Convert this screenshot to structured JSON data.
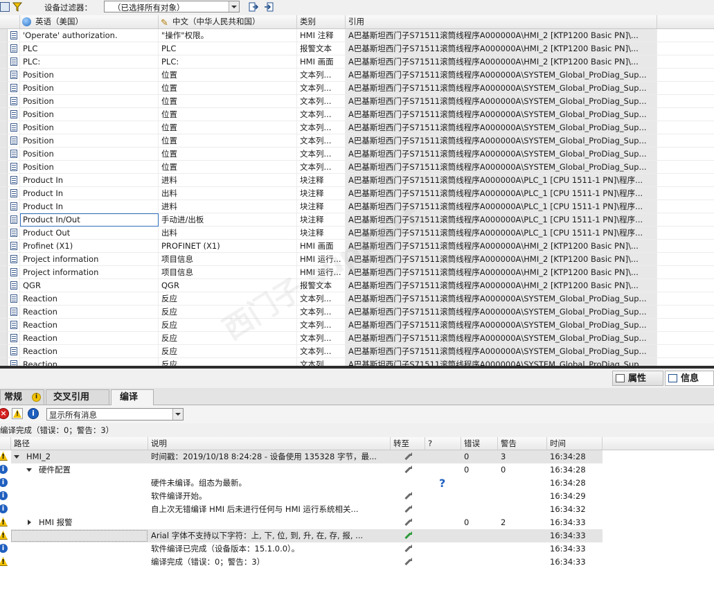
{
  "toolbar": {
    "filter_label": "设备过滤器：",
    "filter_value": "（已选择所有对象）"
  },
  "textlist": {
    "columns": {
      "en": "英语（美国）",
      "zh": "中文（中华人民共和国）",
      "category": "类别",
      "reference": "引用"
    },
    "rows": [
      {
        "en": "'Operate' authorization.",
        "zh": "\"操作\"权限。",
        "cat": "HMI 注释",
        "ref": "A巴基斯坦西门子S71511滚筒线程序A000000A\\HMI_2 [KTP1200 Basic PN]\\..."
      },
      {
        "en": "PLC",
        "zh": "PLC",
        "cat": "报警文本",
        "ref": "A巴基斯坦西门子S71511滚筒线程序A000000A\\HMI_2 [KTP1200 Basic PN]\\..."
      },
      {
        "en": "PLC:",
        "zh": "PLC:",
        "cat": "HMI 画面",
        "ref": "A巴基斯坦西门子S71511滚筒线程序A000000A\\HMI_2 [KTP1200 Basic PN]\\..."
      },
      {
        "en": "Position",
        "zh": "位置",
        "cat": "文本列...",
        "ref": "A巴基斯坦西门子S71511滚筒线程序A000000A\\SYSTEM_Global_ProDiag_Sup..."
      },
      {
        "en": "Position",
        "zh": "位置",
        "cat": "文本列...",
        "ref": "A巴基斯坦西门子S71511滚筒线程序A000000A\\SYSTEM_Global_ProDiag_Sup..."
      },
      {
        "en": "Position",
        "zh": "位置",
        "cat": "文本列...",
        "ref": "A巴基斯坦西门子S71511滚筒线程序A000000A\\SYSTEM_Global_ProDiag_Sup..."
      },
      {
        "en": "Position",
        "zh": "位置",
        "cat": "文本列...",
        "ref": "A巴基斯坦西门子S71511滚筒线程序A000000A\\SYSTEM_Global_ProDiag_Sup..."
      },
      {
        "en": "Position",
        "zh": "位置",
        "cat": "文本列...",
        "ref": "A巴基斯坦西门子S71511滚筒线程序A000000A\\SYSTEM_Global_ProDiag_Sup..."
      },
      {
        "en": "Position",
        "zh": "位置",
        "cat": "文本列...",
        "ref": "A巴基斯坦西门子S71511滚筒线程序A000000A\\SYSTEM_Global_ProDiag_Sup..."
      },
      {
        "en": "Position",
        "zh": "位置",
        "cat": "文本列...",
        "ref": "A巴基斯坦西门子S71511滚筒线程序A000000A\\SYSTEM_Global_ProDiag_Sup..."
      },
      {
        "en": "Position",
        "zh": "位置",
        "cat": "文本列...",
        "ref": "A巴基斯坦西门子S71511滚筒线程序A000000A\\SYSTEM_Global_ProDiag_Sup..."
      },
      {
        "en": "Product In",
        "zh": "进料",
        "cat": "块注释",
        "ref": "A巴基斯坦西门子S71511滚筒线程序A000000A\\PLC_1 [CPU 1511-1 PN]\\程序..."
      },
      {
        "en": "Product In",
        "zh": "出料",
        "cat": "块注释",
        "ref": "A巴基斯坦西门子S71511滚筒线程序A000000A\\PLC_1 [CPU 1511-1 PN]\\程序..."
      },
      {
        "en": "Product In",
        "zh": "进料",
        "cat": "块注释",
        "ref": "A巴基斯坦西门子S71511滚筒线程序A000000A\\PLC_1 [CPU 1511-1 PN]\\程序..."
      },
      {
        "en": "Product In/Out",
        "zh": "手动进/出板",
        "cat": "块注释",
        "ref": "A巴基斯坦西门子S71511滚筒线程序A000000A\\PLC_1 [CPU 1511-1 PN]\\程序..."
      },
      {
        "en": "Product Out",
        "zh": "出料",
        "cat": "块注释",
        "ref": "A巴基斯坦西门子S71511滚筒线程序A000000A\\PLC_1 [CPU 1511-1 PN]\\程序..."
      },
      {
        "en": "Profinet (X1)",
        "zh": "PROFINET (X1)",
        "cat": "HMI 画面",
        "ref": "A巴基斯坦西门子S71511滚筒线程序A000000A\\HMI_2 [KTP1200 Basic PN]\\..."
      },
      {
        "en": "Project information",
        "zh": "项目信息",
        "cat": "HMI 运行...",
        "ref": "A巴基斯坦西门子S71511滚筒线程序A000000A\\HMI_2 [KTP1200 Basic PN]\\..."
      },
      {
        "en": "Project information",
        "zh": "项目信息",
        "cat": "HMI 运行...",
        "ref": "A巴基斯坦西门子S71511滚筒线程序A000000A\\HMI_2 [KTP1200 Basic PN]\\..."
      },
      {
        "en": "QGR",
        "zh": "QGR",
        "cat": "报警文本",
        "ref": "A巴基斯坦西门子S71511滚筒线程序A000000A\\HMI_2 [KTP1200 Basic PN]\\..."
      },
      {
        "en": "Reaction",
        "zh": "反应",
        "cat": "文本列...",
        "ref": "A巴基斯坦西门子S71511滚筒线程序A000000A\\SYSTEM_Global_ProDiag_Sup..."
      },
      {
        "en": "Reaction",
        "zh": "反应",
        "cat": "文本列...",
        "ref": "A巴基斯坦西门子S71511滚筒线程序A000000A\\SYSTEM_Global_ProDiag_Sup..."
      },
      {
        "en": "Reaction",
        "zh": "反应",
        "cat": "文本列...",
        "ref": "A巴基斯坦西门子S71511滚筒线程序A000000A\\SYSTEM_Global_ProDiag_Sup..."
      },
      {
        "en": "Reaction",
        "zh": "反应",
        "cat": "文本列...",
        "ref": "A巴基斯坦西门子S71511滚筒线程序A000000A\\SYSTEM_Global_ProDiag_Sup..."
      },
      {
        "en": "Reaction",
        "zh": "反应",
        "cat": "文本列...",
        "ref": "A巴基斯坦西门子S71511滚筒线程序A000000A\\SYSTEM_Global_ProDiag_Sup..."
      },
      {
        "en": "Reaction",
        "zh": "反应",
        "cat": "文本列...",
        "ref": "A巴基斯坦西门子S71511滚筒线程序A000000A\\SYSTEM_Global_ProDiag_Sup..."
      }
    ]
  },
  "inspector": {
    "properties_tab": "属性",
    "info_tab": "信息",
    "subtabs": {
      "general": "常规",
      "cross_ref": "交叉引用",
      "compile": "编译"
    },
    "filter_value": "显示所有消息",
    "summary": "编译完成（错误：0；警告：3）",
    "columns": {
      "path": "路径",
      "desc": "说明",
      "goto": "转至",
      "q": "?",
      "err": "错误",
      "warn": "警告",
      "time": "时间"
    },
    "messages": [
      {
        "sev": "warn",
        "path": "HMI_2",
        "desc": "时间戳：2019/10/18 8:24:28 - 设备使用 135328 字节，最...",
        "err": "0",
        "warn": "3",
        "time": "16:34:28"
      },
      {
        "sev": "info",
        "path": "硬件配置",
        "desc": "",
        "err": "0",
        "warn": "0",
        "time": "16:34:28"
      },
      {
        "sev": "info",
        "path": "",
        "desc": "硬件未编译。组态为最新。",
        "err": "",
        "warn": "",
        "time": "16:34:28"
      },
      {
        "sev": "info",
        "path": "",
        "desc": "软件编译开始。",
        "err": "",
        "warn": "",
        "time": "16:34:29"
      },
      {
        "sev": "info",
        "path": "",
        "desc": "自上次无错编译 HMI 后未进行任何与 HMI 运行系统相关...",
        "err": "",
        "warn": "",
        "time": "16:34:32"
      },
      {
        "sev": "warn",
        "path": "HMI 报警",
        "desc": "",
        "err": "0",
        "warn": "2",
        "time": "16:34:33"
      },
      {
        "sev": "warn",
        "path": "",
        "desc": "Arial 字体不支持以下字符：上, 下, 位, 到, 升, 在, 存, 报, ...",
        "err": "",
        "warn": "",
        "time": "16:34:33"
      },
      {
        "sev": "info",
        "path": "",
        "desc": "软件编译已完成（设备版本：15.1.0.0）。",
        "err": "",
        "warn": "",
        "time": "16:34:33"
      },
      {
        "sev": "warn",
        "path": "",
        "desc": "编译完成（错误：0；警告：3）",
        "err": "",
        "warn": "",
        "time": "16:34:33"
      }
    ]
  }
}
